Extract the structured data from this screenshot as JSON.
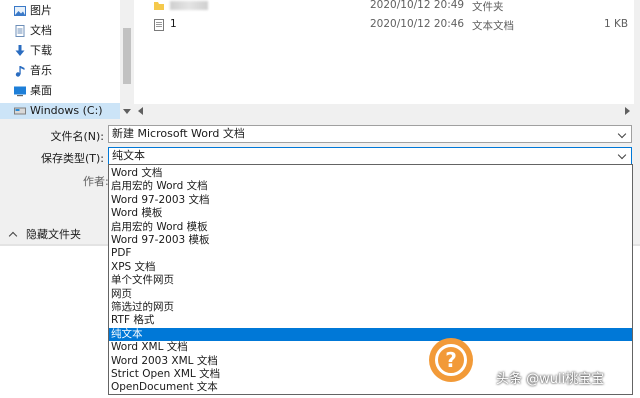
{
  "nav": {
    "items": [
      {
        "label": "图片",
        "icon": "pictures-icon"
      },
      {
        "label": "文档",
        "icon": "documents-icon"
      },
      {
        "label": "下载",
        "icon": "download-arrow-icon"
      },
      {
        "label": "音乐",
        "icon": "music-note-icon"
      },
      {
        "label": "桌面",
        "icon": "desktop-icon"
      },
      {
        "label": "Windows (C:)",
        "icon": "drive-icon"
      }
    ]
  },
  "files": [
    {
      "name": "",
      "date": "2020/10/12 20:49",
      "type": "文件夹",
      "size": ""
    },
    {
      "name": "1",
      "date": "2020/10/12 20:46",
      "type": "文本文档",
      "size": "1 KB"
    }
  ],
  "form": {
    "filename_label": "文件名(N):",
    "filename_value": "新建 Microsoft Word 文档",
    "savetype_label": "保存类型(T):",
    "savetype_value": "纯文本",
    "author_label": "作者:",
    "hide_folders_label": "隐藏文件夹"
  },
  "dropdown": {
    "options": [
      "Word 文档",
      "启用宏的 Word 文档",
      "Word 97-2003 文档",
      "Word 模板",
      "启用宏的 Word 模板",
      "Word 97-2003 模板",
      "PDF",
      "XPS 文档",
      "单个文件网页",
      "网页",
      "筛选过的网页",
      "RTF 格式",
      "纯文本",
      "Word XML 文档",
      "Word 2003 XML 文档",
      "Strict Open XML 文档",
      "OpenDocument 文本"
    ],
    "selected_index": 12
  },
  "watermark": {
    "text": "头条 @wuli桃宝宝",
    "badge": "?"
  },
  "colors": {
    "accent": "#0078d7",
    "watermark_orange": "#f29a38"
  }
}
